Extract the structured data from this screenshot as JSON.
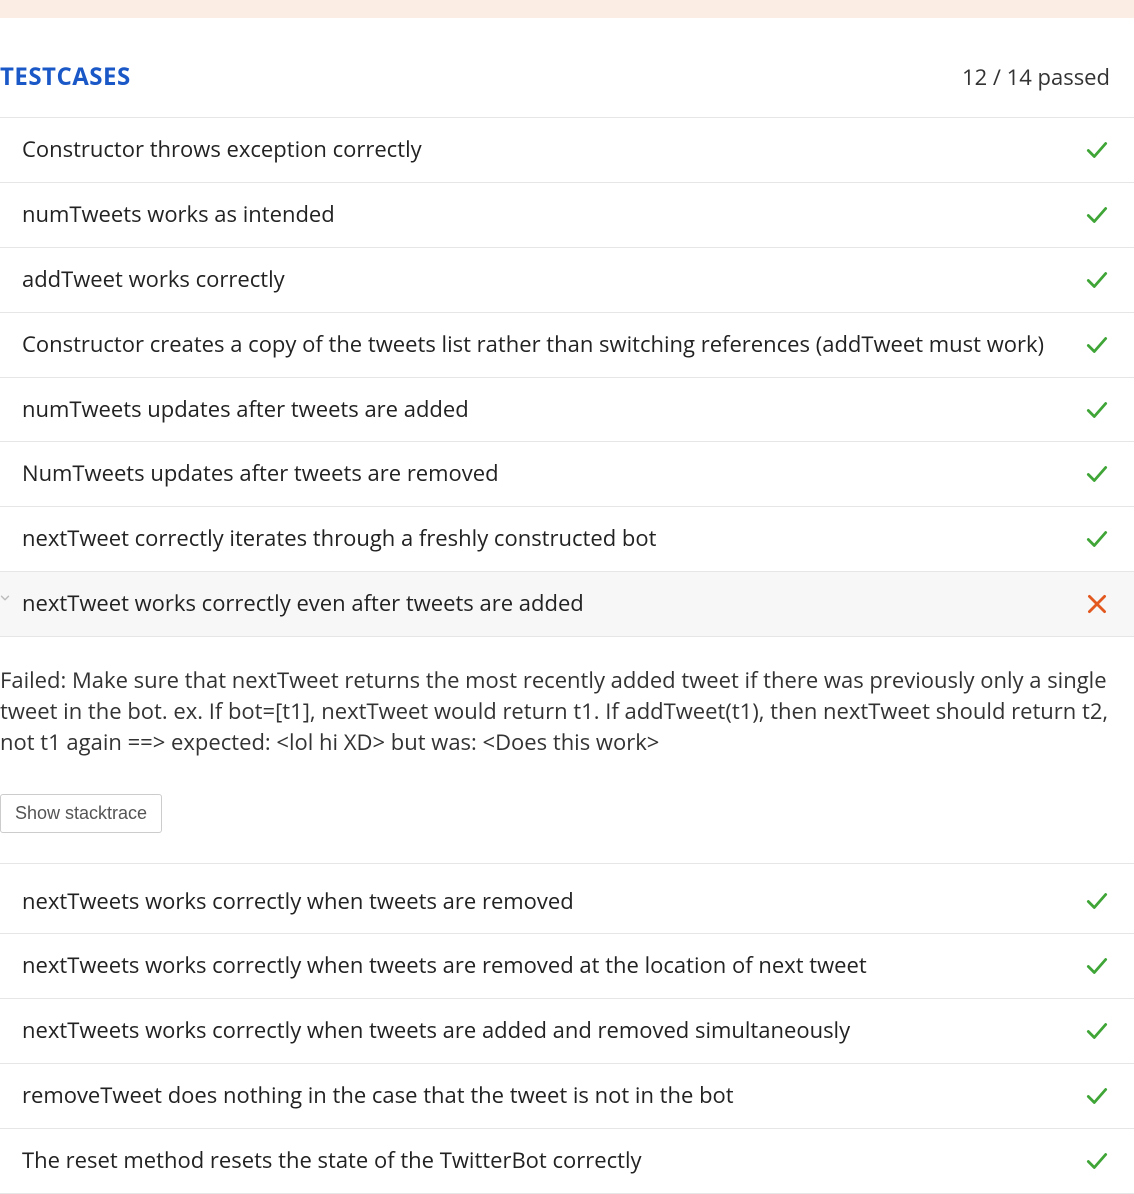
{
  "header": {
    "title": "TESTCASES",
    "summary": "12 / 14 passed"
  },
  "tests": [
    {
      "name": "Constructor throws exception correctly",
      "status": "pass",
      "expanded": false
    },
    {
      "name": "numTweets works as intended",
      "status": "pass",
      "expanded": false
    },
    {
      "name": "addTweet works correctly",
      "status": "pass",
      "expanded": false
    },
    {
      "name": "Constructor creates a copy of the tweets list rather than switching references (addTweet must work)",
      "status": "pass",
      "expanded": false
    },
    {
      "name": "numTweets updates after tweets are added",
      "status": "pass",
      "expanded": false
    },
    {
      "name": "NumTweets updates after tweets are removed",
      "status": "pass",
      "expanded": false
    },
    {
      "name": "nextTweet correctly iterates through a freshly constructed bot",
      "status": "pass",
      "expanded": false
    },
    {
      "name": "nextTweet works correctly even after tweets are added",
      "status": "fail",
      "expanded": true,
      "message": "Failed: Make sure that nextTweet returns the most recently added tweet if there was previously only a single tweet in the bot. ex. If bot=[t1], nextTweet would return t1. If addTweet(t1), then nextTweet should return t2, not t1 again ==> expected: <lol hi XD> but was: <Does this work>",
      "stacktrace_label": "Show stacktrace"
    },
    {
      "name": "nextTweets works correctly when tweets are removed",
      "status": "pass",
      "expanded": false
    },
    {
      "name": "nextTweets works correctly when tweets are removed at the location of next tweet",
      "status": "pass",
      "expanded": false
    },
    {
      "name": "nextTweets works correctly when tweets are added and removed simultaneously",
      "status": "pass",
      "expanded": false
    },
    {
      "name": "removeTweet does nothing in the case that the tweet is not in the bot",
      "status": "pass",
      "expanded": false
    },
    {
      "name": "The reset method resets the state of the TwitterBot correctly",
      "status": "pass",
      "expanded": false
    }
  ]
}
